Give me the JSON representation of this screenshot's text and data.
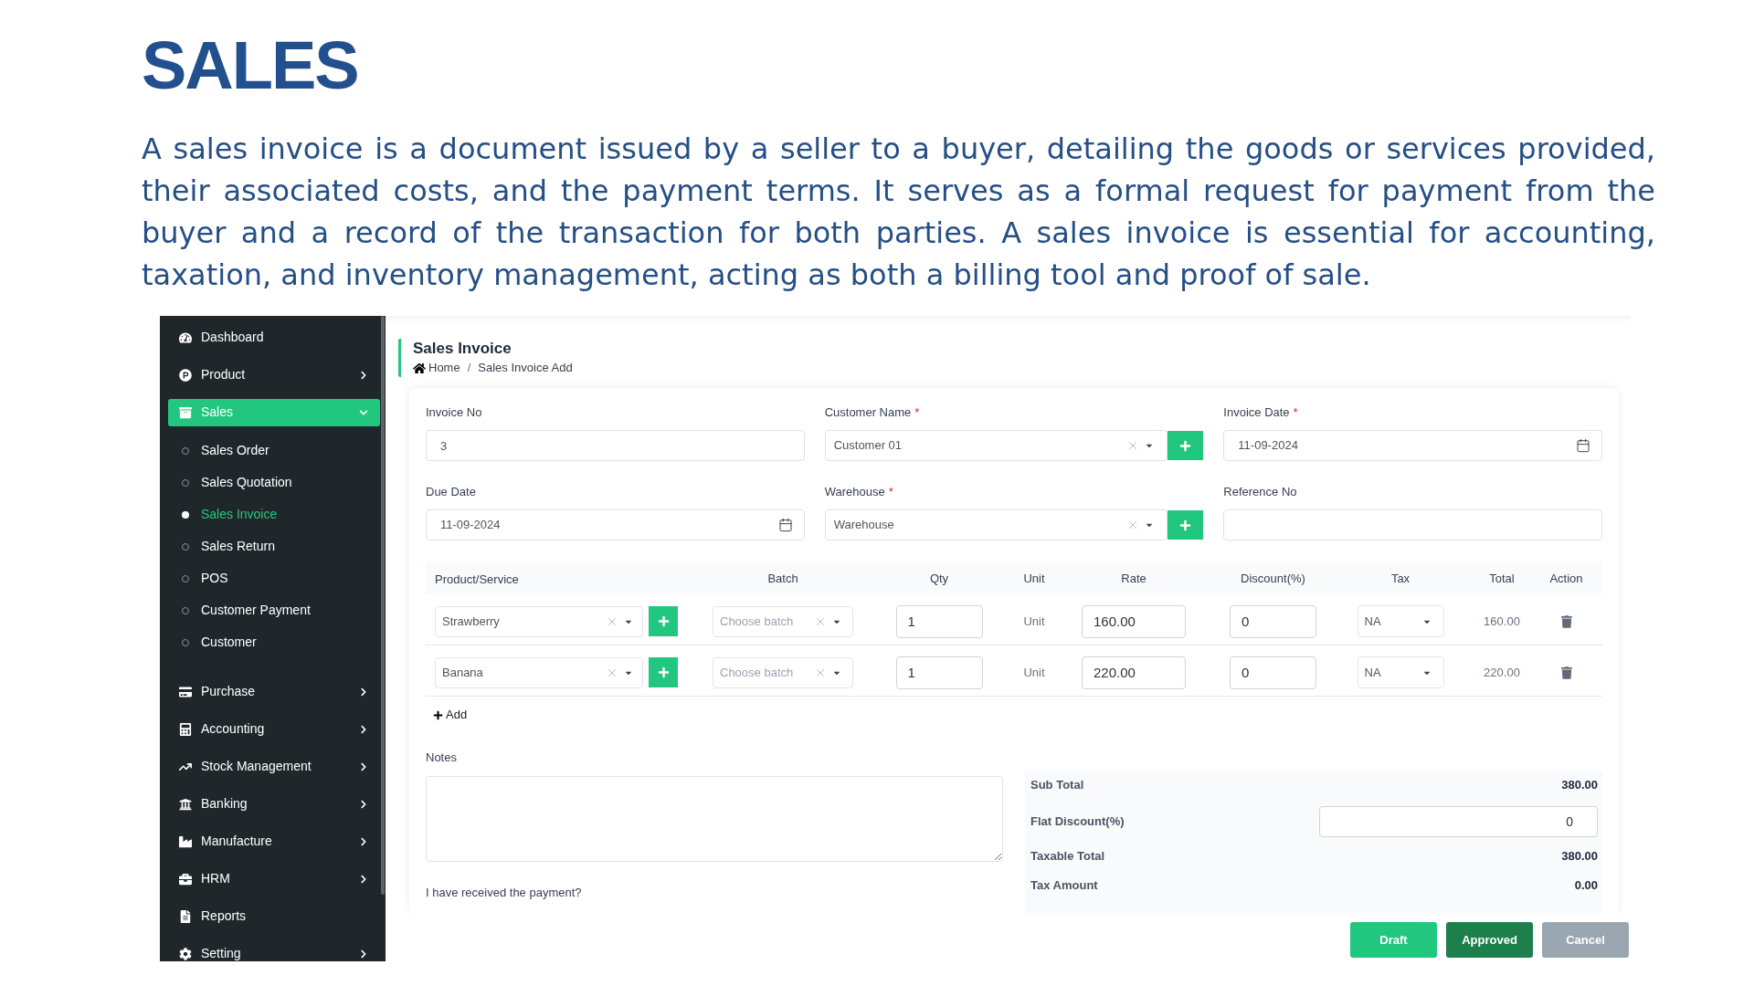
{
  "heading": {
    "title": "SALES",
    "description": "A sales invoice is a document issued by a seller to a buyer, detailing the goods or services provided, their associated costs, and the payment terms. It serves as a formal request for payment from the buyer and a record of the transaction for both parties. A sales invoice is essential for accounting, taxation, and inventory management, acting as both a billing tool and proof of sale."
  },
  "sidebar": {
    "items": [
      {
        "label": "Dashboard",
        "selected": false
      },
      {
        "label": "Product",
        "selected": false,
        "expanded": false
      },
      {
        "label": "Sales",
        "selected": true,
        "expanded": true,
        "children": [
          {
            "label": "Sales Order",
            "selected": false
          },
          {
            "label": "Sales Quotation",
            "selected": false
          },
          {
            "label": "Sales Invoice",
            "selected": true
          },
          {
            "label": "Sales Return",
            "selected": false
          },
          {
            "label": "POS",
            "selected": false
          },
          {
            "label": "Customer Payment",
            "selected": false
          },
          {
            "label": "Customer",
            "selected": false
          }
        ]
      },
      {
        "label": "Purchase",
        "selected": false,
        "expanded": false
      },
      {
        "label": "Accounting",
        "selected": false,
        "expanded": false
      },
      {
        "label": "Stock Management",
        "selected": false,
        "expanded": false
      },
      {
        "label": "Banking",
        "selected": false,
        "expanded": false
      },
      {
        "label": "Manufacture",
        "selected": false,
        "expanded": false
      },
      {
        "label": "HRM",
        "selected": false,
        "expanded": false
      },
      {
        "label": "Reports",
        "selected": false
      },
      {
        "label": "Setting",
        "selected": false,
        "expanded": false
      }
    ]
  },
  "page_header": {
    "title": "Sales Invoice",
    "breadcrumb": [
      "Home",
      "Sales Invoice Add"
    ],
    "separator": "/"
  },
  "form": {
    "fields": [
      {
        "kind": "text",
        "label": "Invoice No",
        "value": "3"
      },
      {
        "kind": "select",
        "label": "Customer Name",
        "required_mark": "*",
        "value": "Customer 01",
        "add_button": true
      },
      {
        "kind": "date",
        "label": "Invoice Date",
        "required_mark": "*",
        "value": "11-09-2024"
      },
      {
        "kind": "date",
        "label": "Due Date",
        "value": "11-09-2024"
      },
      {
        "kind": "select",
        "label": "Warehouse",
        "required_mark": "*",
        "value": "Warehouse",
        "add_button": true
      },
      {
        "kind": "text",
        "label": "Reference No"
      }
    ]
  },
  "items_table": {
    "columns": [
      "Product/Service",
      "Batch",
      "Qty",
      "Unit",
      "Rate",
      "Discount(%)",
      "Tax",
      "Total",
      "Action"
    ],
    "rows": [
      {
        "product": "Strawberry",
        "batch_placeholder": "Choose batch",
        "qty": "1",
        "unit": "Unit",
        "rate": "160.00",
        "discount": "0",
        "tax": "NA",
        "total": "160.00"
      },
      {
        "product": "Banana",
        "batch_placeholder": "Choose batch",
        "qty": "1",
        "unit": "Unit",
        "rate": "220.00",
        "discount": "0",
        "tax": "NA",
        "total": "220.00"
      }
    ],
    "add_link": "Add"
  },
  "notes": {
    "label": "Notes"
  },
  "payment_check": {
    "label": "I have received the payment?"
  },
  "totals": [
    {
      "kind": "value",
      "label": "Sub Total",
      "value": "380.00"
    },
    {
      "kind": "input",
      "label": "Flat Discount(%)",
      "value": "0"
    },
    {
      "kind": "value",
      "label": "Taxable Total",
      "value": "380.00"
    },
    {
      "kind": "value",
      "label": "Tax Amount",
      "value": "0.00"
    }
  ],
  "actions": [
    {
      "kind": "draft",
      "label": "Draft"
    },
    {
      "kind": "approve",
      "label": "Approved"
    },
    {
      "kind": "cancel",
      "label": "Cancel"
    }
  ]
}
